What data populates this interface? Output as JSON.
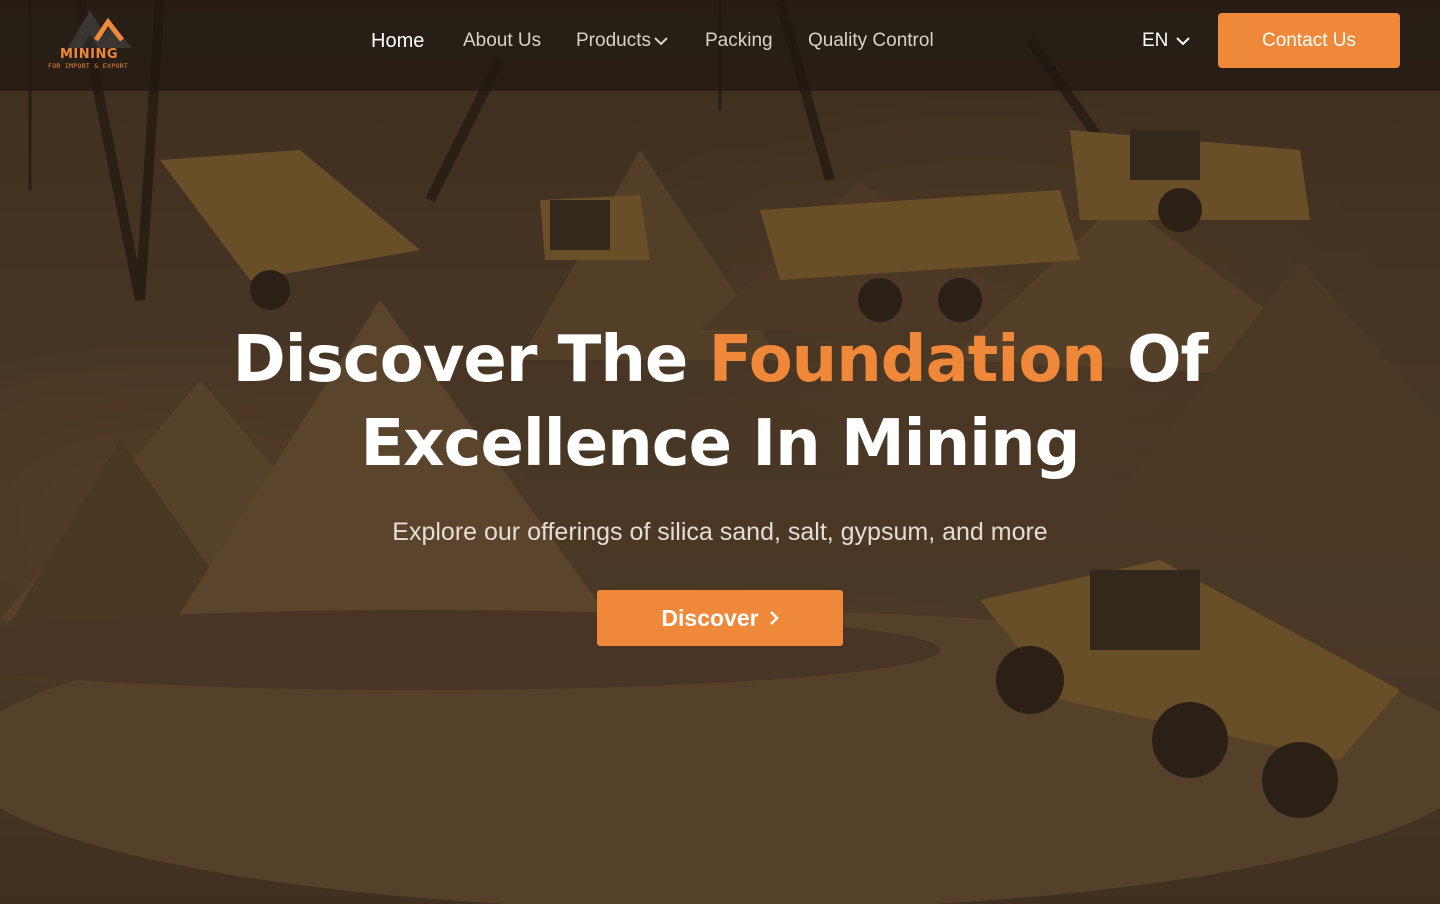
{
  "brand": {
    "name": "MINING",
    "tagline": "FOR IMPORT & EXPORT",
    "accent_color": "#f0883a"
  },
  "nav": {
    "items": [
      {
        "label": "Home",
        "active": true
      },
      {
        "label": "About Us"
      },
      {
        "label": "Products",
        "has_dropdown": true
      },
      {
        "label": "Packing"
      },
      {
        "label": "Quality Control"
      }
    ],
    "language": "EN",
    "contact_label": "Contact Us"
  },
  "hero": {
    "headline_part1": "Discover The",
    "headline_accent": "Foundation",
    "headline_part2": "Of",
    "headline_line2": "Excellence In Mining",
    "subtitle": "Explore our offerings of silica sand, salt, gypsum, and more",
    "cta_label": "Discover",
    "cta_icon": "chevron-right-icon"
  }
}
